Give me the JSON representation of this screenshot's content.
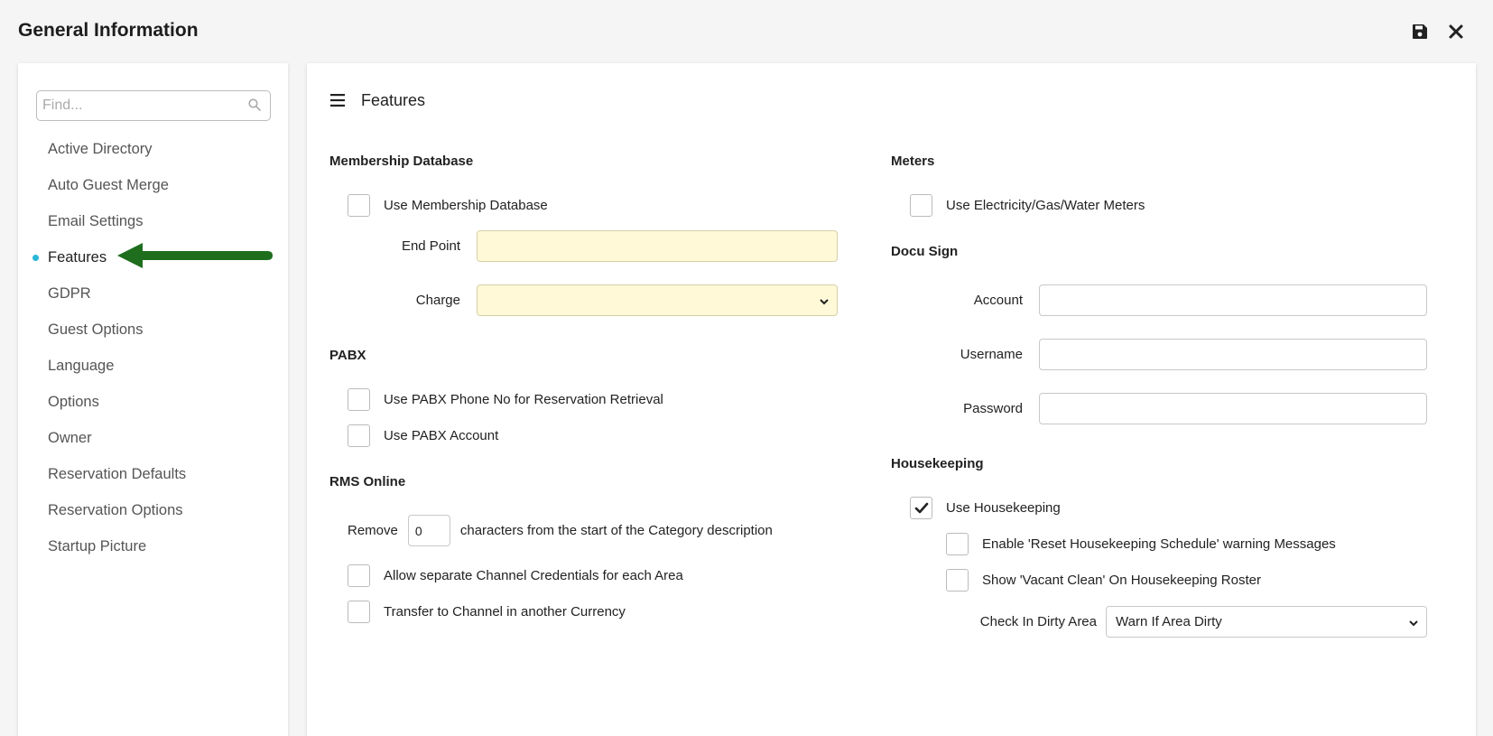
{
  "window": {
    "title": "General Information"
  },
  "toolbar": {
    "save_icon": "save-icon",
    "close_icon": "close-icon"
  },
  "sidebar": {
    "search_placeholder": "Find...",
    "items": [
      {
        "label": "Active Directory",
        "active": false
      },
      {
        "label": "Auto Guest Merge",
        "active": false
      },
      {
        "label": "Email Settings",
        "active": false
      },
      {
        "label": "Features",
        "active": true
      },
      {
        "label": "GDPR",
        "active": false
      },
      {
        "label": "Guest Options",
        "active": false
      },
      {
        "label": "Language",
        "active": false
      },
      {
        "label": "Options",
        "active": false
      },
      {
        "label": "Owner",
        "active": false
      },
      {
        "label": "Reservation Defaults",
        "active": false
      },
      {
        "label": "Reservation Options",
        "active": false
      },
      {
        "label": "Startup Picture",
        "active": false
      }
    ]
  },
  "main": {
    "title": "Features",
    "membership": {
      "heading": "Membership Database",
      "use_label": "Use Membership Database",
      "use_checked": false,
      "endpoint_label": "End Point",
      "endpoint_value": "",
      "charge_label": "Charge",
      "charge_value": ""
    },
    "pabx": {
      "heading": "PABX",
      "phone_label": "Use PABX Phone No for Reservation Retrieval",
      "phone_checked": false,
      "account_label": "Use PABX Account",
      "account_checked": false
    },
    "rms_online": {
      "heading": "RMS Online",
      "remove_label": "Remove",
      "remove_value": "0",
      "remove_suffix": "characters from the start of the Category description",
      "separate_label": "Allow separate Channel Credentials for each Area",
      "separate_checked": false,
      "transfer_label": "Transfer to Channel in another Currency",
      "transfer_checked": false
    },
    "meters": {
      "heading": "Meters",
      "use_label": "Use Electricity/Gas/Water Meters",
      "use_checked": false
    },
    "docusign": {
      "heading": "Docu Sign",
      "account_label": "Account",
      "account_value": "",
      "username_label": "Username",
      "username_value": "",
      "password_label": "Password",
      "password_value": ""
    },
    "housekeeping": {
      "heading": "Housekeeping",
      "use_label": "Use Housekeeping",
      "use_checked": true,
      "reset_label": "Enable 'Reset Housekeeping Schedule' warning Messages",
      "reset_checked": false,
      "vacant_label": "Show 'Vacant Clean' On Housekeeping Roster",
      "vacant_checked": false,
      "dirty_label": "Check In Dirty Area",
      "dirty_value": "Warn If Area Dirty"
    }
  },
  "colors": {
    "accent_dot": "#29b6d8",
    "arrow": "#1e6e1e",
    "required_field": "#fff9d7"
  }
}
